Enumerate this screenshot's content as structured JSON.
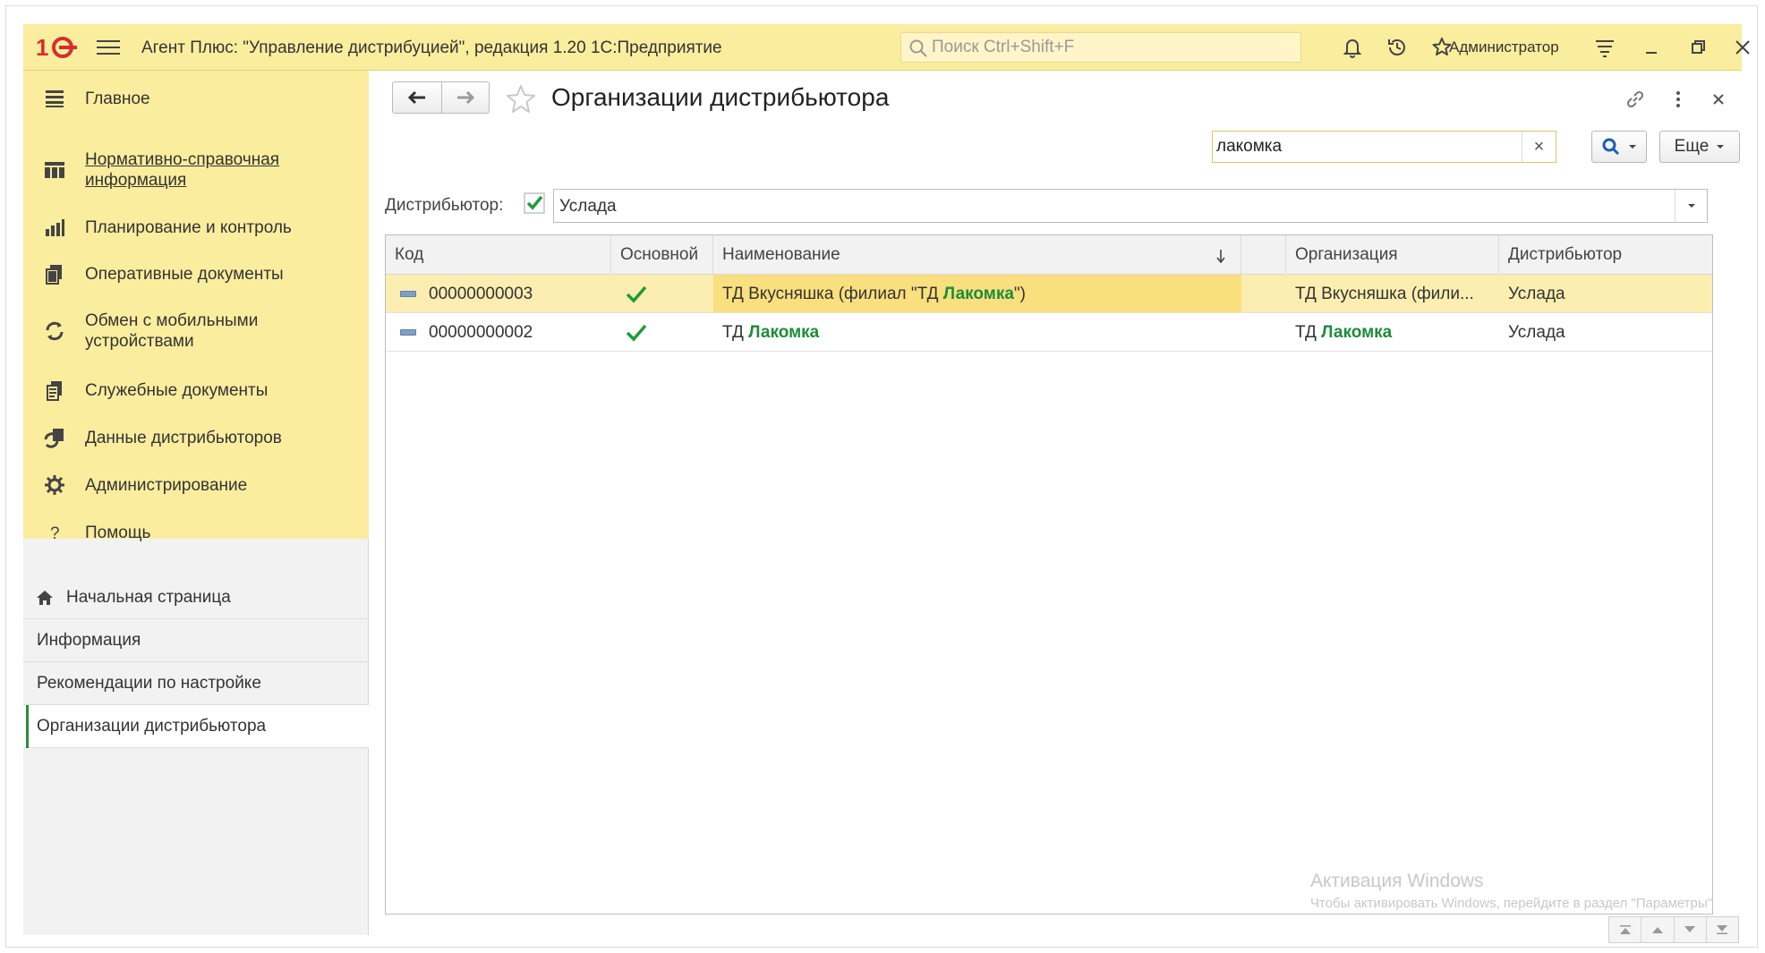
{
  "titlebar": {
    "app_title": "Агент Плюс: \"Управление дистрибуцией\", редакция 1.20 1С:Предприятие",
    "search_placeholder": "Поиск Ctrl+Shift+F",
    "user": "Администратор",
    "accent": "#fbed9e"
  },
  "sidebar": {
    "sections": [
      {
        "label": "Главное",
        "icon": "menu-lines-icon"
      },
      {
        "label": "Нормативно-справочная\nинформация",
        "icon": "grid-icon"
      },
      {
        "label": "Планирование и контроль",
        "icon": "chart-icon"
      },
      {
        "label": "Оперативные документы",
        "icon": "documents-icon"
      },
      {
        "label": "Обмен с мобильными\nустройствами",
        "icon": "sync-icon"
      },
      {
        "label": "Служебные документы",
        "icon": "service-docs-icon"
      },
      {
        "label": "Данные дистрибьюторов",
        "icon": "distributor-data-icon"
      },
      {
        "label": "Администрирование",
        "icon": "gear-icon"
      },
      {
        "label": "Помощь",
        "icon": "help-icon"
      }
    ],
    "pages": [
      {
        "label": "Начальная страница"
      },
      {
        "label": "Информация"
      },
      {
        "label": "Рекомендации по настройке"
      },
      {
        "label": "Организации дистрибьютора"
      }
    ]
  },
  "form": {
    "title": "Организации дистрибьютора",
    "search_value": "лакомка",
    "more_label": "Еще",
    "filter_label": "Дистрибьютор:",
    "filter_value": "Услада",
    "filter_checked": true
  },
  "table": {
    "columns": [
      "Код",
      "Основной",
      "Наименование",
      "",
      "Организация",
      "Дистрибьютор"
    ],
    "rows": [
      {
        "code": "00000000003",
        "main": true,
        "name_before": "ТД Вкусняшка (филиал \"ТД ",
        "name_hl": "Лакомка",
        "name_after": "\")",
        "org_before": "ТД Вкусняшка (фили...",
        "org_hl": "",
        "distributor": "Услада"
      },
      {
        "code": "00000000002",
        "main": true,
        "name_before": "ТД ",
        "name_hl": "Лакомка",
        "name_after": "",
        "org_before": "ТД ",
        "org_hl": "Лакомка",
        "distributor": "Услада"
      }
    ]
  },
  "watermark": {
    "line1": "Активация Windows",
    "line2": "Чтобы активировать Windows, перейдите в раздел \"Параметры\"."
  }
}
